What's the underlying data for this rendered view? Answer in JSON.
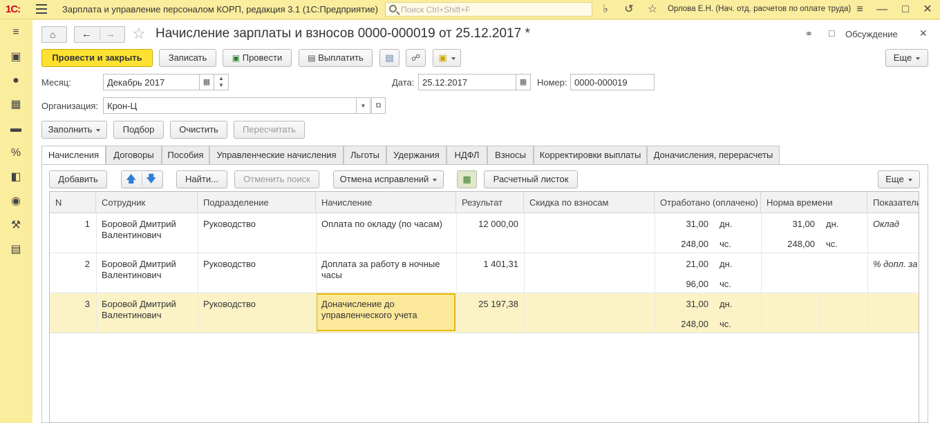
{
  "app": {
    "logo": "1С:",
    "title": "Зарплата и управление персоналом КОРП, редакция 3.1  (1С:Предприятие)",
    "search_placeholder": "Поиск Ctrl+Shift+F",
    "user": "Орлова Е.Н. (Нач. отд. расчетов по оплате труда)"
  },
  "document": {
    "title": "Начисление зарплаты и взносов 0000-000019 от 25.12.2017 *",
    "discussion_label": "Обсуждение"
  },
  "toolbar": {
    "post_close": "Провести и закрыть",
    "save": "Записать",
    "post": "Провести",
    "pay": "Выплатить",
    "more": "Еще"
  },
  "form": {
    "month_label": "Месяц:",
    "month_value": "Декабрь 2017",
    "date_label": "Дата:",
    "date_value": "25.12.2017",
    "number_label": "Номер:",
    "number_value": "0000-000019",
    "org_label": "Организация:",
    "org_value": "Крон-Ц"
  },
  "actions": {
    "fill": "Заполнить",
    "pick": "Подбор",
    "clear": "Очистить",
    "recalc": "Пересчитать"
  },
  "tabs": [
    {
      "label": "Начисления",
      "active": true
    },
    {
      "label": "Договоры"
    },
    {
      "label": "Пособия"
    },
    {
      "label": "Управленческие начисления"
    },
    {
      "label": "Льготы"
    },
    {
      "label": "Удержания"
    },
    {
      "label": "НДФЛ"
    },
    {
      "label": "Взносы"
    },
    {
      "label": "Корректировки выплаты"
    },
    {
      "label": "Доначисления, перерасчеты"
    }
  ],
  "grid_toolbar": {
    "add": "Добавить",
    "find": "Найти...",
    "cancel_search": "Отменить поиск",
    "cancel_corrections": "Отмена исправлений",
    "payslip": "Расчетный листок",
    "more": "Еще"
  },
  "grid": {
    "columns": [
      "N",
      "Сотрудник",
      "Подразделение",
      "Начисление",
      "Результат",
      "Скидка по взносам",
      "Отработано (оплачено)",
      "Норма времени",
      "Показатели"
    ],
    "rows": [
      {
        "n": "1",
        "employee_1": "Боровой Дмитрий",
        "employee_2": "Валентинович",
        "dept": "Руководство",
        "accrual_1": "Оплата по окладу (по часам)",
        "accrual_2": "",
        "result": "12 000,00",
        "worked_1": "31,00",
        "worked_unit_1": "дн.",
        "worked_2": "248,00",
        "worked_unit_2": "чс.",
        "norm_1": "31,00",
        "norm_unit_1": "дн.",
        "norm_2": "248,00",
        "norm_unit_2": "чс.",
        "indicator": "Оклад"
      },
      {
        "n": "2",
        "employee_1": "Боровой Дмитрий",
        "employee_2": "Валентинович",
        "dept": "Руководство",
        "accrual_1": "Доплата за работу в ночные",
        "accrual_2": "часы",
        "result": "1 401,31",
        "worked_1": "21,00",
        "worked_unit_1": "дн.",
        "worked_2": "96,00",
        "worked_unit_2": "чс.",
        "norm_1": "",
        "norm_unit_1": "",
        "norm_2": "",
        "norm_unit_2": "",
        "indicator": "% допл. за"
      },
      {
        "n": "3",
        "employee_1": "Боровой Дмитрий",
        "employee_2": "Валентинович",
        "dept": "Руководство",
        "accrual_1": "Доначисление до",
        "accrual_2": "управленческого учета",
        "result": "25 197,38",
        "worked_1": "31,00",
        "worked_unit_1": "дн.",
        "worked_2": "248,00",
        "worked_unit_2": "чс.",
        "norm_1": "",
        "norm_unit_1": "",
        "norm_2": "",
        "norm_unit_2": "",
        "indicator": ""
      }
    ]
  }
}
